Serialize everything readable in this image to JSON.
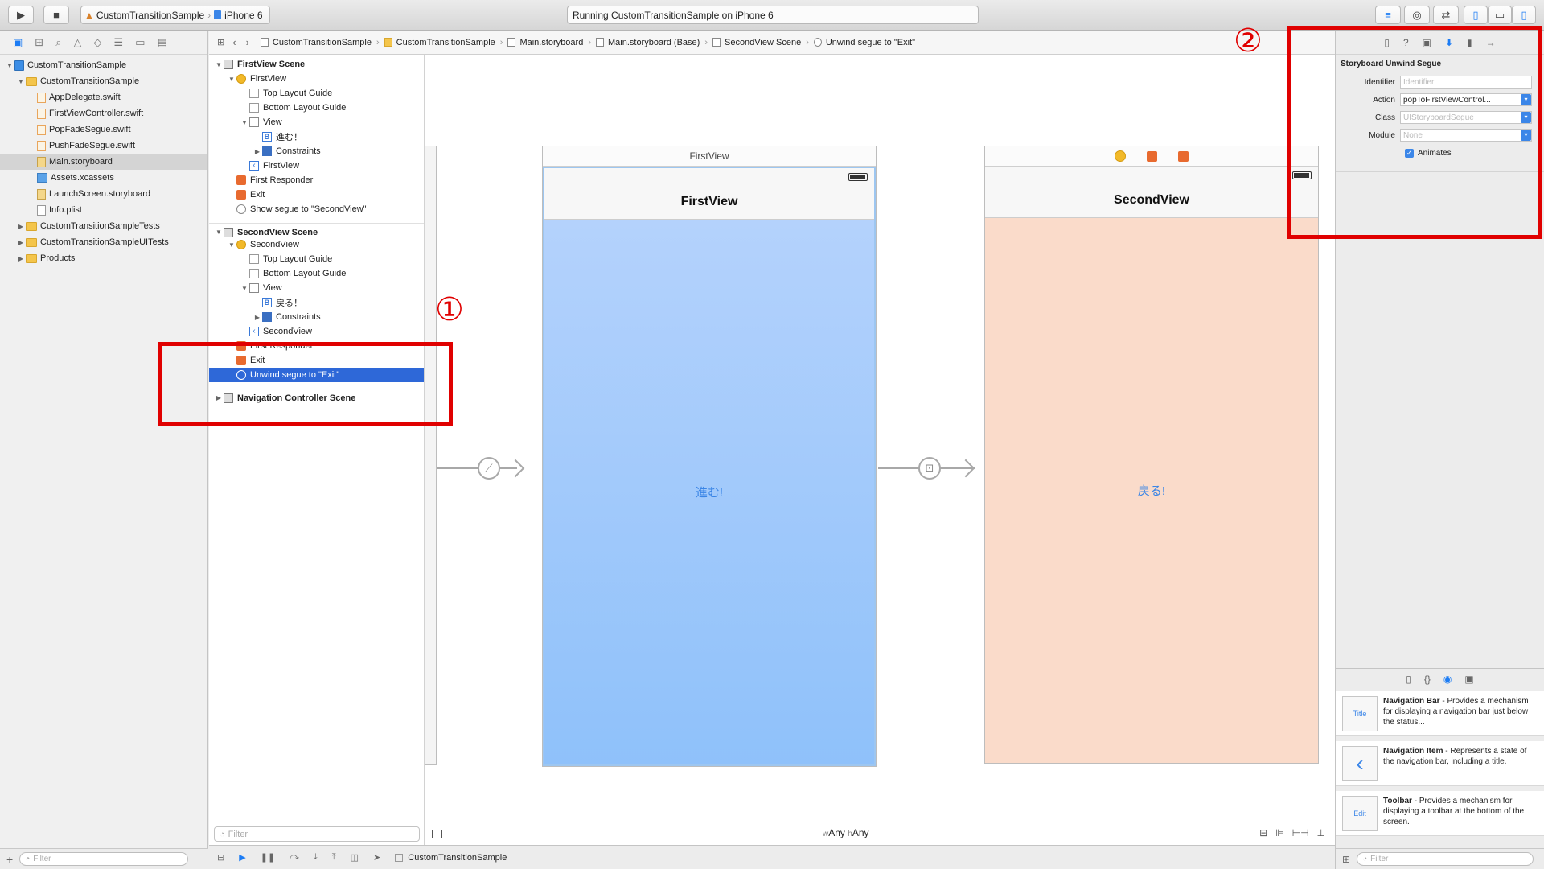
{
  "toolbar": {
    "scheme_target": "CustomTransitionSample",
    "scheme_device": "iPhone 6",
    "status": "Running CustomTransitionSample on iPhone 6"
  },
  "navigator": {
    "items": [
      {
        "label": "CustomTransitionSample",
        "indent": 0,
        "icon": "project",
        "disclosure": "open"
      },
      {
        "label": "CustomTransitionSample",
        "indent": 1,
        "icon": "folder",
        "disclosure": "open"
      },
      {
        "label": "AppDelegate.swift",
        "indent": 2,
        "icon": "swift"
      },
      {
        "label": "FirstViewController.swift",
        "indent": 2,
        "icon": "swift"
      },
      {
        "label": "PopFadeSegue.swift",
        "indent": 2,
        "icon": "swift"
      },
      {
        "label": "PushFadeSegue.swift",
        "indent": 2,
        "icon": "swift"
      },
      {
        "label": "Main.storyboard",
        "indent": 2,
        "icon": "storyboard",
        "selected": true
      },
      {
        "label": "Assets.xcassets",
        "indent": 2,
        "icon": "assets"
      },
      {
        "label": "LaunchScreen.storyboard",
        "indent": 2,
        "icon": "storyboard"
      },
      {
        "label": "Info.plist",
        "indent": 2,
        "icon": "plist"
      },
      {
        "label": "CustomTransitionSampleTests",
        "indent": 1,
        "icon": "folder",
        "disclosure": "closed"
      },
      {
        "label": "CustomTransitionSampleUITests",
        "indent": 1,
        "icon": "folder",
        "disclosure": "closed"
      },
      {
        "label": "Products",
        "indent": 1,
        "icon": "folder",
        "disclosure": "closed"
      }
    ],
    "filter_placeholder": "Filter"
  },
  "jumpbar": {
    "crumbs": [
      "CustomTransitionSample",
      "CustomTransitionSample",
      "Main.storyboard",
      "Main.storyboard (Base)",
      "SecondView Scene",
      "Unwind segue to \"Exit\""
    ]
  },
  "outline": {
    "rows": [
      {
        "label": "FirstView Scene",
        "indent": 0,
        "icon": "scene",
        "disclosure": "open",
        "bold": true
      },
      {
        "label": "FirstView",
        "indent": 1,
        "icon": "vc",
        "disclosure": "open"
      },
      {
        "label": "Top Layout Guide",
        "indent": 2,
        "icon": "guide"
      },
      {
        "label": "Bottom Layout Guide",
        "indent": 2,
        "icon": "guide"
      },
      {
        "label": "View",
        "indent": 2,
        "icon": "view",
        "disclosure": "open"
      },
      {
        "label": "進む！",
        "indent": 3,
        "icon": "btn"
      },
      {
        "label": "Constraints",
        "indent": 3,
        "icon": "cons",
        "disclosure": "closed"
      },
      {
        "label": "FirstView",
        "indent": 2,
        "icon": "nav"
      },
      {
        "label": "First Responder",
        "indent": 1,
        "icon": "fr"
      },
      {
        "label": "Exit",
        "indent": 1,
        "icon": "exit"
      },
      {
        "label": "Show segue to \"SecondView\"",
        "indent": 1,
        "icon": "seg"
      },
      {
        "label": "SecondView Scene",
        "indent": 0,
        "icon": "scene",
        "disclosure": "open",
        "bold": true,
        "section": true
      },
      {
        "label": "SecondView",
        "indent": 1,
        "icon": "vc",
        "disclosure": "open"
      },
      {
        "label": "Top Layout Guide",
        "indent": 2,
        "icon": "guide"
      },
      {
        "label": "Bottom Layout Guide",
        "indent": 2,
        "icon": "guide"
      },
      {
        "label": "View",
        "indent": 2,
        "icon": "view",
        "disclosure": "open"
      },
      {
        "label": "戻る！",
        "indent": 3,
        "icon": "btn"
      },
      {
        "label": "Constraints",
        "indent": 3,
        "icon": "cons",
        "disclosure": "closed"
      },
      {
        "label": "SecondView",
        "indent": 2,
        "icon": "nav"
      },
      {
        "label": "First Responder",
        "indent": 1,
        "icon": "fr"
      },
      {
        "label": "Exit",
        "indent": 1,
        "icon": "exit"
      },
      {
        "label": "Unwind segue to \"Exit\"",
        "indent": 1,
        "icon": "seg",
        "selected": true
      },
      {
        "label": "Navigation Controller Scene",
        "indent": 0,
        "icon": "scene",
        "disclosure": "closed",
        "bold": true,
        "section": true
      }
    ],
    "filter_placeholder": "Filter"
  },
  "canvas": {
    "first_frame_title": "FirstView",
    "first_nav_title": "FirstView",
    "first_button": "進む!",
    "second_nav_title": "SecondView",
    "second_button": "戻る!",
    "size_w_prefix": "w",
    "size_w": "Any",
    "size_h_prefix": "h",
    "size_h": "Any",
    "first_bg_top": "#b4d2fc",
    "first_bg_bottom": "#8fc1fa",
    "second_bg": "#fadbca"
  },
  "inspector": {
    "title": "Storyboard Unwind Segue",
    "identifier_label": "Identifier",
    "identifier_placeholder": "Identifier",
    "action_label": "Action",
    "action_value": "popToFirstViewControl...",
    "class_label": "Class",
    "class_placeholder": "UIStoryboardSegue",
    "module_label": "Module",
    "module_placeholder": "None",
    "animates_label": "Animates"
  },
  "library": {
    "items": [
      {
        "title": "Navigation Bar",
        "desc": " - Provides a mechanism for displaying a navigation bar just below the status...",
        "thumb": "Title"
      },
      {
        "title": "Navigation Item",
        "desc": " - Represents a state of the navigation bar, including a title.",
        "thumb": "‹"
      },
      {
        "title": "Toolbar",
        "desc": " - Provides a mechanism for displaying a toolbar at the bottom of the screen.",
        "thumb": "Edit"
      }
    ],
    "filter_placeholder": "Filter"
  },
  "debugbar": {
    "target": "CustomTransitionSample"
  },
  "annotations": {
    "one": "①",
    "two": "②",
    "color": "#e00000"
  }
}
